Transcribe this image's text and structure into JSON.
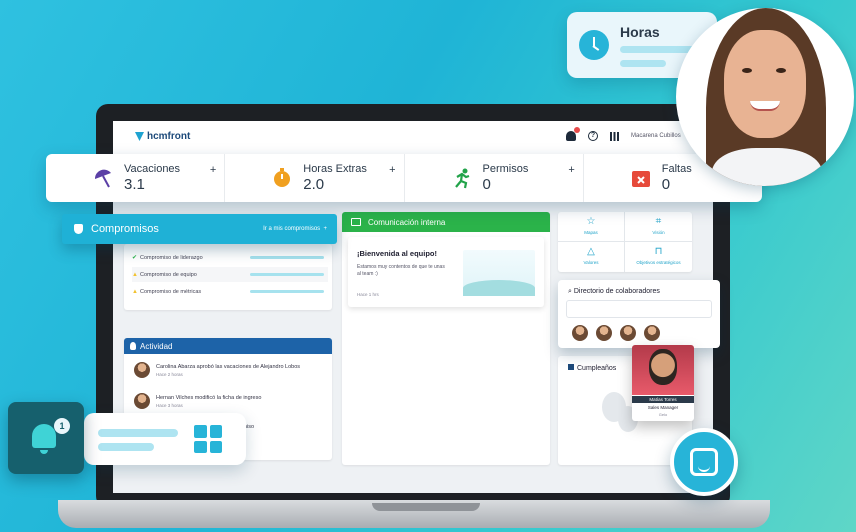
{
  "topbar": {
    "logo": "hcmfront",
    "user_name": "Macarena Cubillos",
    "notification_icon": "bell-icon",
    "help_icon": "help-icon",
    "apps_icon": "grid-icon"
  },
  "stats": [
    {
      "label": "Vacaciones",
      "value": "3.1",
      "icon": "umbrella-icon",
      "color": "#5b3fa6"
    },
    {
      "label": "Horas Extras",
      "value": "2.0",
      "icon": "stopwatch-icon",
      "color": "#f0a020"
    },
    {
      "label": "Permisos",
      "value": "0",
      "icon": "running-person-icon",
      "color": "#22a34a"
    },
    {
      "label": "Faltas",
      "value": "0",
      "icon": "calendar-x-icon",
      "color": "#e64a3a"
    }
  ],
  "compromisos": {
    "title": "Compromisos",
    "link": "Ir a mis compromisos",
    "items": [
      {
        "label": "Compromiso de liderazgo",
        "mark": "✔",
        "mark_color": "#2bb34a"
      },
      {
        "label": "Compromiso de equipo",
        "mark": "▲",
        "mark_color": "#f2c230"
      },
      {
        "label": "Compromiso de métricas",
        "mark": "▲",
        "mark_color": "#f2c230"
      }
    ]
  },
  "actividad": {
    "title": "Actividad",
    "items": [
      {
        "text": "Carolina Abarza aprobó las vacaciones de Alejandro Lobos",
        "time": "Hace 2 horas"
      },
      {
        "text": "Hernan Vilches modificó la ficha de ingreso",
        "time": "Hace 3 horas"
      },
      {
        "text": "…ermiso",
        "time": ""
      }
    ]
  },
  "comunicacion": {
    "title": "Comunicación interna",
    "card_title": "¡Bienvenida al equipo!",
    "card_body": "Estamos muy contentos de que te unas al team :)",
    "card_date": "Hace 1 hrs"
  },
  "quick_access": [
    {
      "label": "Mapas",
      "icon": "star-icon"
    },
    {
      "label": "Visión",
      "icon": "scan-icon"
    },
    {
      "label": "Valores",
      "icon": "triangle-icon"
    },
    {
      "label": "Objetivos estratégicos",
      "icon": "bookmark-icon"
    }
  ],
  "directorio": {
    "title": "Directorio de colaboradores",
    "placeholder": ""
  },
  "cumpleanos": {
    "title": "Cumpleaños",
    "person_name": "Matías Torres",
    "person_role": "Sales Manager",
    "person_company": "Gelo"
  },
  "horas": {
    "title": "Horas"
  },
  "notification": {
    "count": "1"
  }
}
